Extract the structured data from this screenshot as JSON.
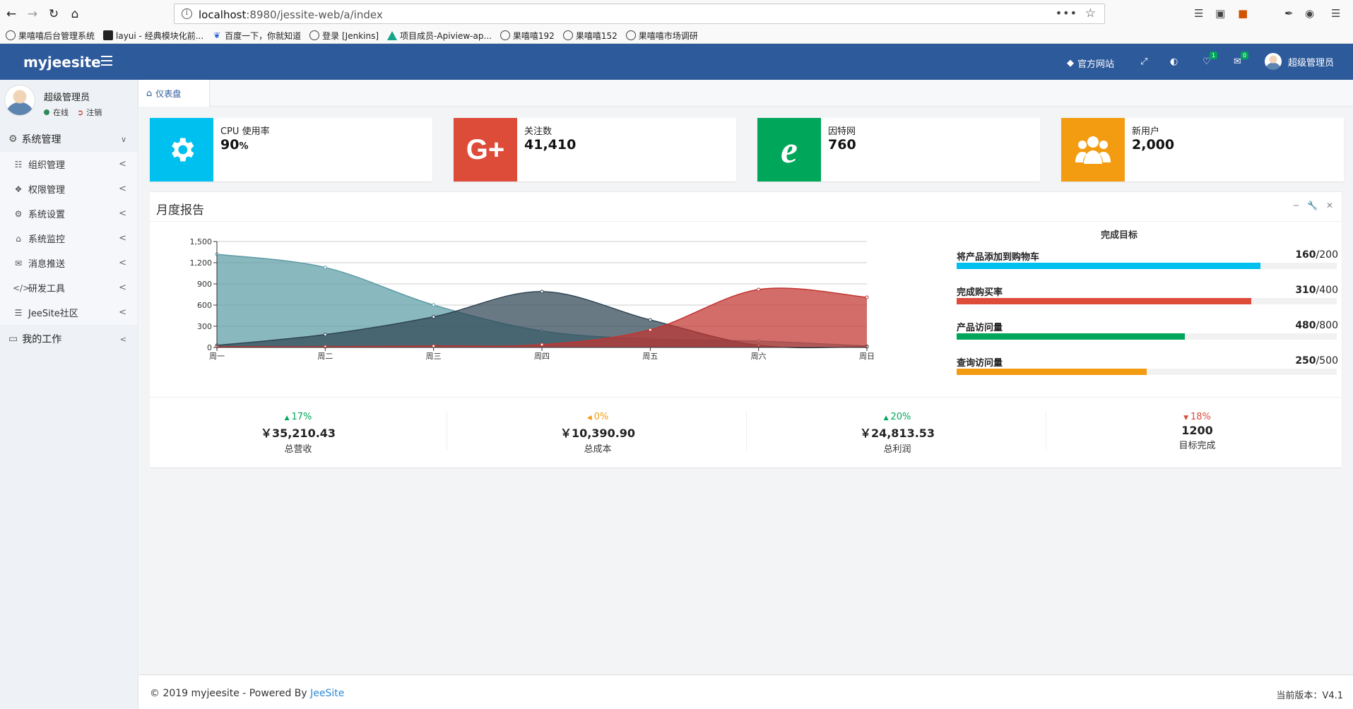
{
  "browser": {
    "url_host": "localhost",
    "url_rest": ":8980/jessite-web/a/index",
    "bookmarks": [
      {
        "label": "果嘻嘻后台管理系统",
        "icon": "globe-icon"
      },
      {
        "label": "layui - 经典模块化前...",
        "icon": "layui-icon"
      },
      {
        "label": "百度一下，你就知道",
        "icon": "baidu-paw-icon"
      },
      {
        "label": "登录 [Jenkins]",
        "icon": "globe-icon"
      },
      {
        "label": "项目成员-Apiview-ap...",
        "icon": "apiview-icon"
      },
      {
        "label": "果嘻嘻192",
        "icon": "globe-icon"
      },
      {
        "label": "果嘻嘻152",
        "icon": "globe-icon"
      },
      {
        "label": "果嘻嘻市场调研",
        "icon": "globe-icon"
      }
    ]
  },
  "header": {
    "logo": "myjeesite",
    "official_site": "官方网站",
    "notif_count": "1",
    "msg_count": "0",
    "user": "超级管理员"
  },
  "sidebar": {
    "user_name": "超级管理员",
    "status": "在线",
    "logout": "注销",
    "group1": "系统管理",
    "items": [
      {
        "label": "组织管理",
        "icon": "grid-icon"
      },
      {
        "label": "权限管理",
        "icon": "layers-icon"
      },
      {
        "label": "系统设置",
        "icon": "gear-icon"
      },
      {
        "label": "系统监控",
        "icon": "monitor-icon"
      },
      {
        "label": "消息推送",
        "icon": "message-icon"
      },
      {
        "label": "研发工具",
        "icon": "code-icon"
      },
      {
        "label": "JeeSite社区",
        "icon": "community-icon"
      }
    ],
    "group2": "我的工作"
  },
  "tab": {
    "label": "仪表盘"
  },
  "infoboxes": [
    {
      "label": "CPU 使用率",
      "value": "90",
      "unit": "%",
      "color": "#00c0ef",
      "icon": "gear-icon"
    },
    {
      "label": "关注数",
      "value": "41,410",
      "unit": "",
      "color": "#dd4b39",
      "icon": "google-plus-icon"
    },
    {
      "label": "因特网",
      "value": "760",
      "unit": "",
      "color": "#00a65a",
      "icon": "ie-icon"
    },
    {
      "label": "新用户",
      "value": "2,000",
      "unit": "",
      "color": "#f39c12",
      "icon": "users-icon"
    }
  ],
  "report": {
    "title": "月度报告",
    "goals_title": "完成目标",
    "goals": [
      {
        "label": "将产品添加到购物车",
        "value": "160",
        "total": "/200",
        "color": "#00c0ef"
      },
      {
        "label": "完成购买率",
        "value": "310",
        "total": "/400",
        "color": "#dd4b39"
      },
      {
        "label": "产品访问量",
        "value": "480",
        "total": "/800",
        "color": "#00a65a"
      },
      {
        "label": "查询访问量",
        "value": "250",
        "total": "/500",
        "color": "#f39c12"
      }
    ],
    "stats": [
      {
        "pct": "17%",
        "dir": "up",
        "amount": "￥35,210.43",
        "label": "总营收"
      },
      {
        "pct": "0%",
        "dir": "nu",
        "amount": "￥10,390.90",
        "label": "总成本"
      },
      {
        "pct": "20%",
        "dir": "up",
        "amount": "￥24,813.53",
        "label": "总利润"
      },
      {
        "pct": "18%",
        "dir": "dn",
        "amount": "1200",
        "label": "目标完成"
      }
    ]
  },
  "chart_data": {
    "type": "area",
    "categories": [
      "周一",
      "周二",
      "周三",
      "周四",
      "周五",
      "周六",
      "周日"
    ],
    "ylim": [
      0,
      1500
    ],
    "yticks": [
      "0",
      "300",
      "600",
      "900",
      "1,200",
      "1,500"
    ],
    "grid": true,
    "series": [
      {
        "values": [
          1320,
          1132,
          601,
          234,
          120,
          90,
          20
        ],
        "color": "#5d9ca6"
      },
      {
        "values": [
          30,
          182,
          434,
          791,
          390,
          30,
          10
        ],
        "color": "#2f4554"
      },
      {
        "values": [
          10,
          10,
          20,
          40,
          250,
          820,
          710
        ],
        "color": "#c23531"
      }
    ]
  },
  "footer": {
    "copyright": "© 2019 myjeesite - Powered By ",
    "link": "JeeSite",
    "version_label": "当前版本：",
    "version": "V4.1"
  }
}
